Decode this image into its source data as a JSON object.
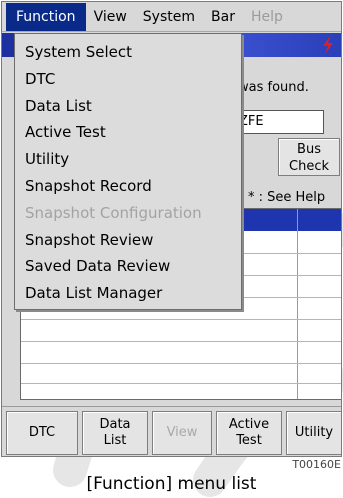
{
  "menubar": {
    "items": [
      "Function",
      "View",
      "System",
      "Bar",
      "Help"
    ]
  },
  "dropdown": {
    "items": [
      {
        "label": "System Select",
        "enabled": true
      },
      {
        "label": "DTC",
        "enabled": true
      },
      {
        "label": "Data List",
        "enabled": true
      },
      {
        "label": "Active Test",
        "enabled": true
      },
      {
        "label": "Utility",
        "enabled": true
      },
      {
        "label": "Snapshot Record",
        "enabled": true
      },
      {
        "label": "Snapshot Configuration",
        "enabled": false
      },
      {
        "label": "Snapshot Review",
        "enabled": true
      },
      {
        "label": "Saved Data Review",
        "enabled": true
      },
      {
        "label": "Data List Manager",
        "enabled": true
      }
    ]
  },
  "status": {
    "message": "was found.",
    "field_value": "ZFE",
    "bus_check_label": "Bus\nCheck",
    "see_help": "* : See Help"
  },
  "bottombar": {
    "dtc": "DTC",
    "data_list": "Data\nList",
    "view": "View",
    "active_test": "Active\nTest",
    "utility": "Utility"
  },
  "figure_code": "T00160E",
  "caption": "[Function] menu list",
  "colors": {
    "menu_highlight": "#0a2a8a",
    "title_blue": "#1f35b0",
    "bolt": "#e02020",
    "watermark": "#e6e6e6"
  }
}
